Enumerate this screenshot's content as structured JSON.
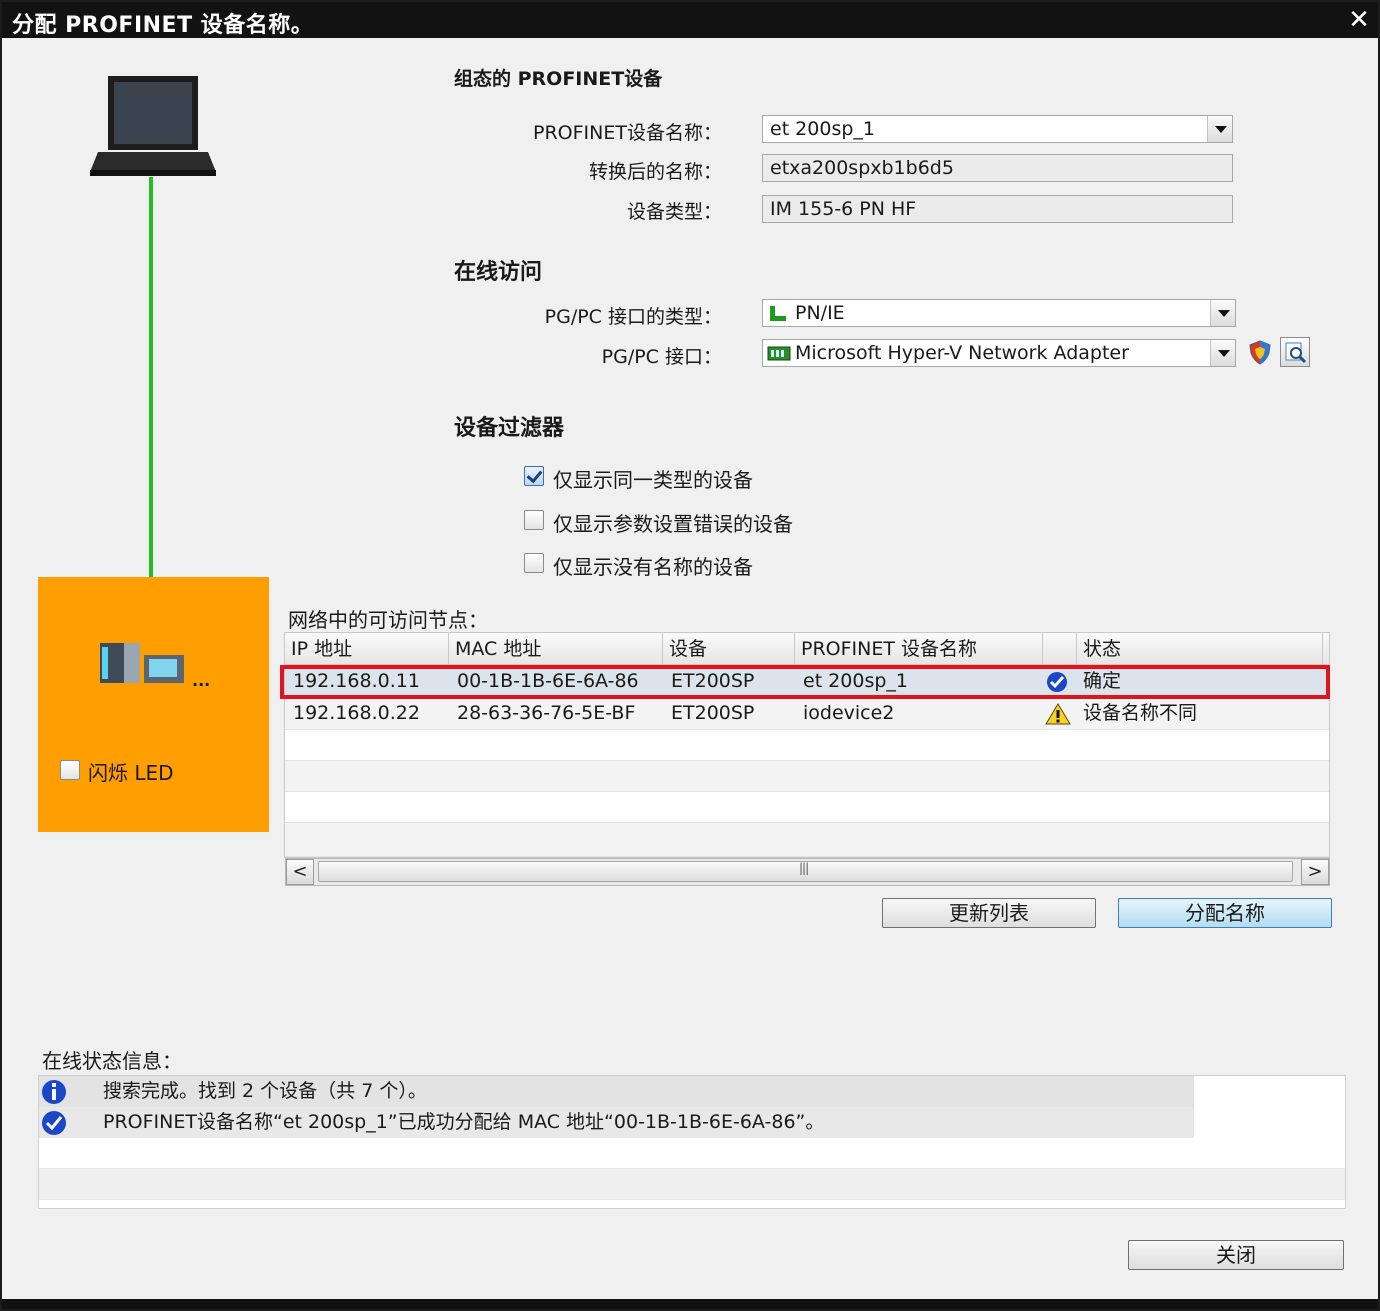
{
  "window": {
    "title": "分配 PROFINET 设备名称。",
    "close_glyph": "✕"
  },
  "configured": {
    "heading": "组态的 PROFINET设备",
    "name_label": "PROFINET设备名称：",
    "name_value": "et 200sp_1",
    "converted_label": "转换后的名称：",
    "converted_value": "etxa200spxb1b6d5",
    "type_label": "设备类型：",
    "type_value": "IM 155-6 PN HF"
  },
  "online_access": {
    "heading": "在线访问",
    "iface_type_label": "PG/PC 接口的类型：",
    "iface_type_value": "PN/IE",
    "iface_label": "PG/PC 接口：",
    "iface_value": "Microsoft Hyper-V Network Adapter"
  },
  "filter": {
    "heading": "设备过滤器",
    "options": [
      {
        "label": "仅显示同一类型的设备",
        "checked": true
      },
      {
        "label": "仅显示参数设置错误的设备",
        "checked": false
      },
      {
        "label": "仅显示没有名称的设备",
        "checked": false
      }
    ]
  },
  "nodes": {
    "label": "网络中的可访问节点：",
    "columns": [
      "IP 地址",
      "MAC 地址",
      "设备",
      "PROFINET 设备名称",
      "",
      "状态"
    ],
    "rows": [
      {
        "ip": "192.168.0.11",
        "mac": "00-1B-1B-6E-6A-86",
        "device": "ET200SP",
        "name": "et 200sp_1",
        "status_icon": "check-circle-icon",
        "status": "确定"
      },
      {
        "ip": "192.168.0.22",
        "mac": "28-63-36-76-5E-BF",
        "device": "ET200SP",
        "name": "iodevice2",
        "status_icon": "warning-icon",
        "status": "设备名称不同"
      }
    ]
  },
  "buttons": {
    "refresh": "更新列表",
    "assign": "分配名称",
    "close": "关闭"
  },
  "left_panel": {
    "flash_led_label": "闪烁 LED",
    "ellipsis": "..."
  },
  "status_info": {
    "label": "在线状态信息：",
    "messages": [
      {
        "icon": "info-icon",
        "text": "搜索完成。找到 2 个设备（共 7 个）。"
      },
      {
        "icon": "check-circle-icon",
        "text": "PROFINET设备名称“et 200sp_1”已成功分配给 MAC 地址“00-1B-1B-6E-6A-86”。"
      }
    ]
  },
  "colors": {
    "highlight": "#e0151b",
    "link_line": "#22c022",
    "device_panel": "#ff9e00"
  }
}
